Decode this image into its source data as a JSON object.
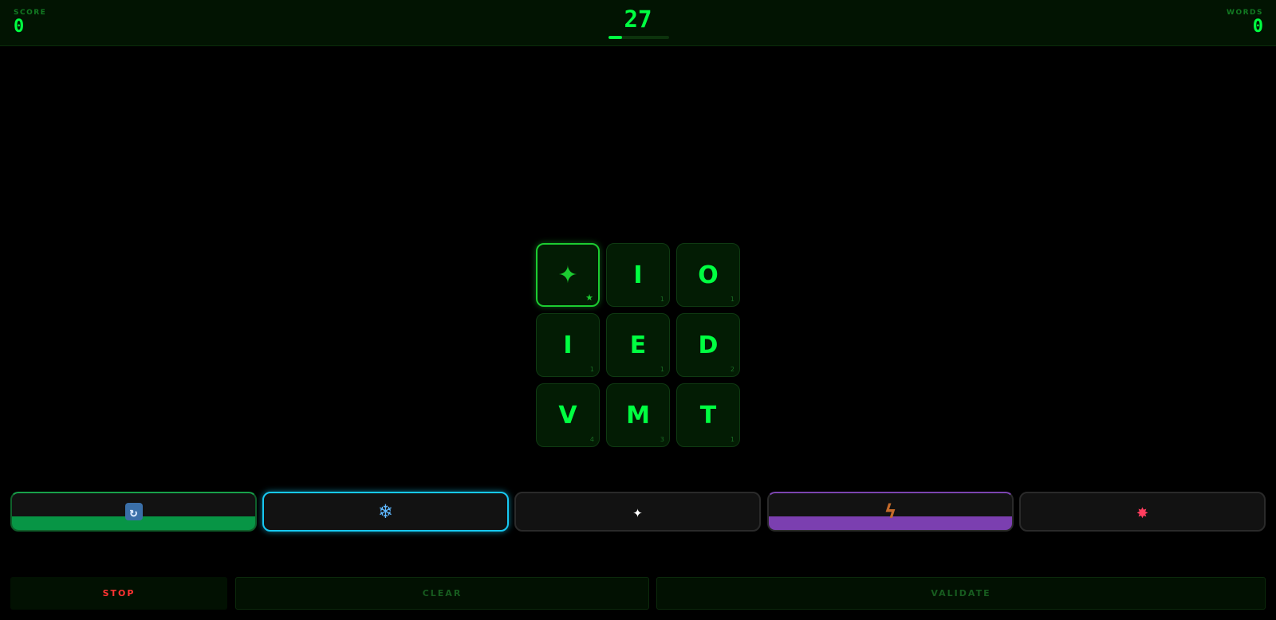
{
  "header": {
    "score_label": "SCORE",
    "score_value": "0",
    "timer": "27",
    "timer_progress": 0.22,
    "words_label": "WORDS",
    "words_value": "0"
  },
  "grid": {
    "tiles": [
      {
        "letter": "✦",
        "points": "★",
        "type": "wild"
      },
      {
        "letter": "I",
        "points": "1"
      },
      {
        "letter": "O",
        "points": "1"
      },
      {
        "letter": "I",
        "points": "1"
      },
      {
        "letter": "E",
        "points": "1"
      },
      {
        "letter": "D",
        "points": "2"
      },
      {
        "letter": "V",
        "points": "4"
      },
      {
        "letter": "M",
        "points": "3"
      },
      {
        "letter": "T",
        "points": "1"
      }
    ]
  },
  "powerups": [
    {
      "icon": "refresh-icon",
      "glyph": "↻",
      "charge": 0.36,
      "color": "#079545"
    },
    {
      "icon": "snowflake-icon",
      "glyph": "❄",
      "active": true,
      "color": "#17c8f2"
    },
    {
      "icon": "sparkle-icon",
      "glyph": "✦"
    },
    {
      "icon": "lightning-icon",
      "glyph": "ϟ",
      "charge": 0.38,
      "color": "#7b3fb0"
    },
    {
      "icon": "explosion-icon",
      "glyph": "✸"
    }
  ],
  "actions": {
    "stop": "STOP",
    "clear": "CLEAR",
    "validate": "VALIDATE"
  },
  "colors": {
    "accent": "#00ff41",
    "wild": "#1ccc31",
    "stop": "#ff3333"
  }
}
